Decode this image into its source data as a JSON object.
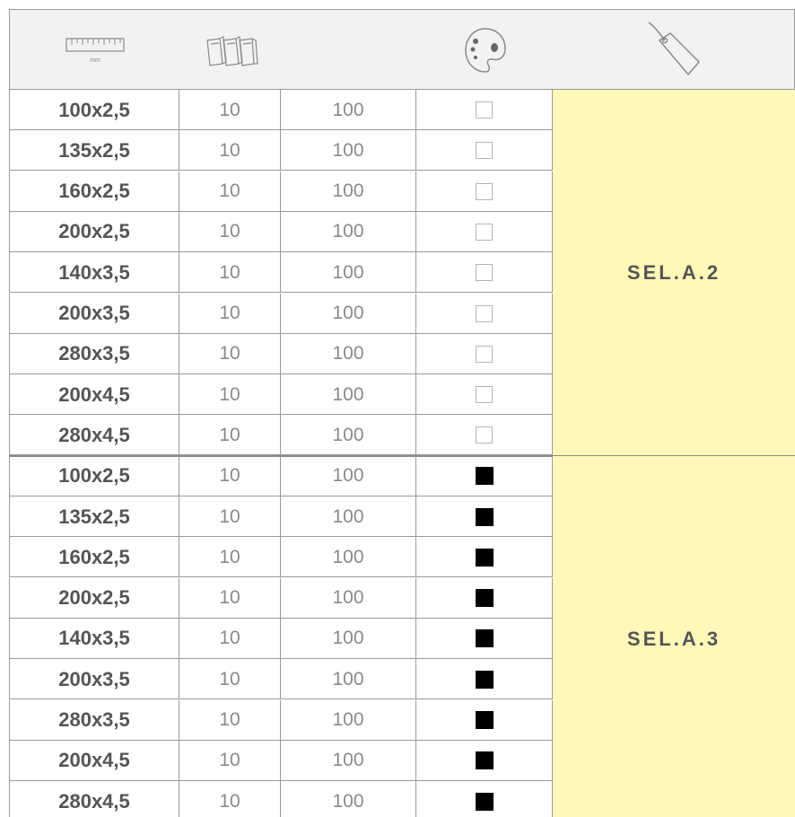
{
  "header": {
    "icons": [
      "ruler-icon",
      "boxes-icon",
      "",
      "palette-icon",
      "price-tag-icon"
    ],
    "ruler_unit": "mm"
  },
  "groups": [
    {
      "code": "SEL.A.2",
      "checkbox": "empty",
      "rows": [
        {
          "size": "100x2,5",
          "qty": "10",
          "pack": "100"
        },
        {
          "size": "135x2,5",
          "qty": "10",
          "pack": "100"
        },
        {
          "size": "160x2,5",
          "qty": "10",
          "pack": "100"
        },
        {
          "size": "200x2,5",
          "qty": "10",
          "pack": "100"
        },
        {
          "size": "140x3,5",
          "qty": "10",
          "pack": "100"
        },
        {
          "size": "200x3,5",
          "qty": "10",
          "pack": "100"
        },
        {
          "size": "280x3,5",
          "qty": "10",
          "pack": "100"
        },
        {
          "size": "200x4,5",
          "qty": "10",
          "pack": "100"
        },
        {
          "size": "280x4,5",
          "qty": "10",
          "pack": "100"
        }
      ]
    },
    {
      "code": "SEL.A.3",
      "checkbox": "filled",
      "rows": [
        {
          "size": "100x2,5",
          "qty": "10",
          "pack": "100"
        },
        {
          "size": "135x2,5",
          "qty": "10",
          "pack": "100"
        },
        {
          "size": "160x2,5",
          "qty": "10",
          "pack": "100"
        },
        {
          "size": "200x2,5",
          "qty": "10",
          "pack": "100"
        },
        {
          "size": "140x3,5",
          "qty": "10",
          "pack": "100"
        },
        {
          "size": "200x3,5",
          "qty": "10",
          "pack": "100"
        },
        {
          "size": "280x3,5",
          "qty": "10",
          "pack": "100"
        },
        {
          "size": "200x4,5",
          "qty": "10",
          "pack": "100"
        },
        {
          "size": "280x4,5",
          "qty": "10",
          "pack": "100"
        }
      ]
    }
  ],
  "colors": {
    "header_bg": "#f2f2f2",
    "code_bg": "#fff8b8",
    "border": "#9a9a9a",
    "text_bold": "#555555",
    "text_light": "#8a8a8a"
  }
}
